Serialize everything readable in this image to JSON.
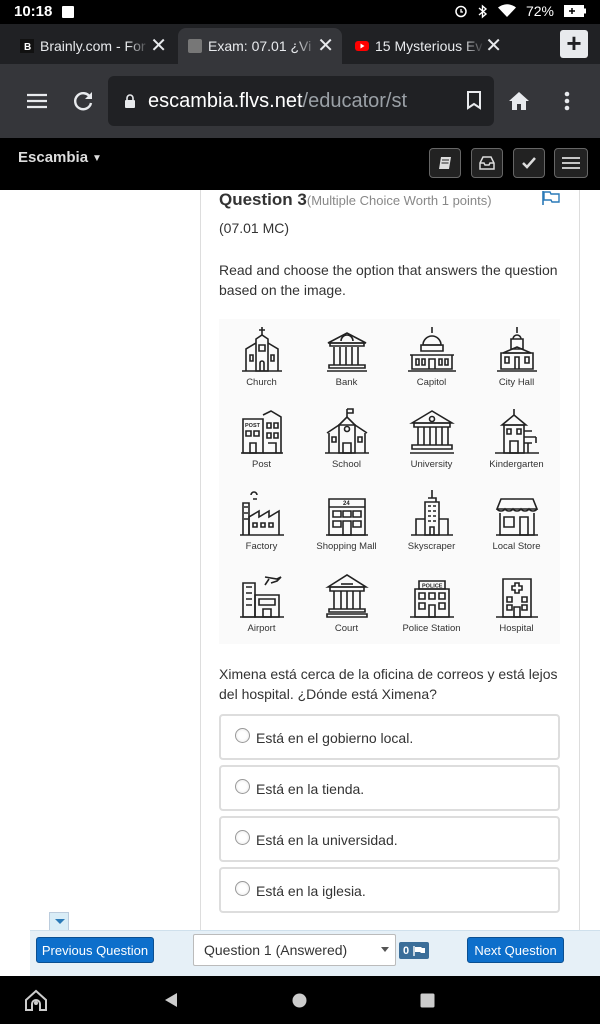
{
  "status_bar": {
    "time": "10:18",
    "battery": "72%"
  },
  "tabs": [
    {
      "title": "Brainly.com - For",
      "active": false
    },
    {
      "title": "Exam: 07.01 ¿Vi",
      "active": true
    },
    {
      "title": "15 Mysterious Ev",
      "active": false
    }
  ],
  "omnibox": {
    "host": "escambia.flvs.net",
    "path": "/educator/st"
  },
  "site_nav": {
    "brand": "Escambia"
  },
  "question": {
    "number_label": "Question 3",
    "worth": "(Multiple Choice Worth 1 points)",
    "code": "(07.01 MC)",
    "instruction": "Read and choose the option that answers the question based on the image.",
    "prompt": "Ximena está cerca de la oficina de correos y está lejos del hospital. ¿Dónde está Ximena?",
    "options": [
      "Está en el gobierno local.",
      "Está en la tienda.",
      "Está en la universidad.",
      "Está en la iglesia."
    ]
  },
  "buildings": [
    "Church",
    "Bank",
    "Capitol",
    "City Hall",
    "Post",
    "School",
    "University",
    "Kindergarten",
    "Factory",
    "Shopping Mall",
    "Skyscraper",
    "Local Store",
    "Airport",
    "Court",
    "Police Station",
    "Hospital"
  ],
  "building_signs": {
    "post": "POST",
    "mall": "24",
    "police": "POLICE"
  },
  "bottom_bar": {
    "prev_label": "Previous Question",
    "next_label": "Next Question",
    "select_value": "Question 1 (Answered)",
    "flag_count": "0"
  },
  "colors": {
    "primary_button": "#0d6fcb",
    "flag_blue": "#3b6e99"
  }
}
